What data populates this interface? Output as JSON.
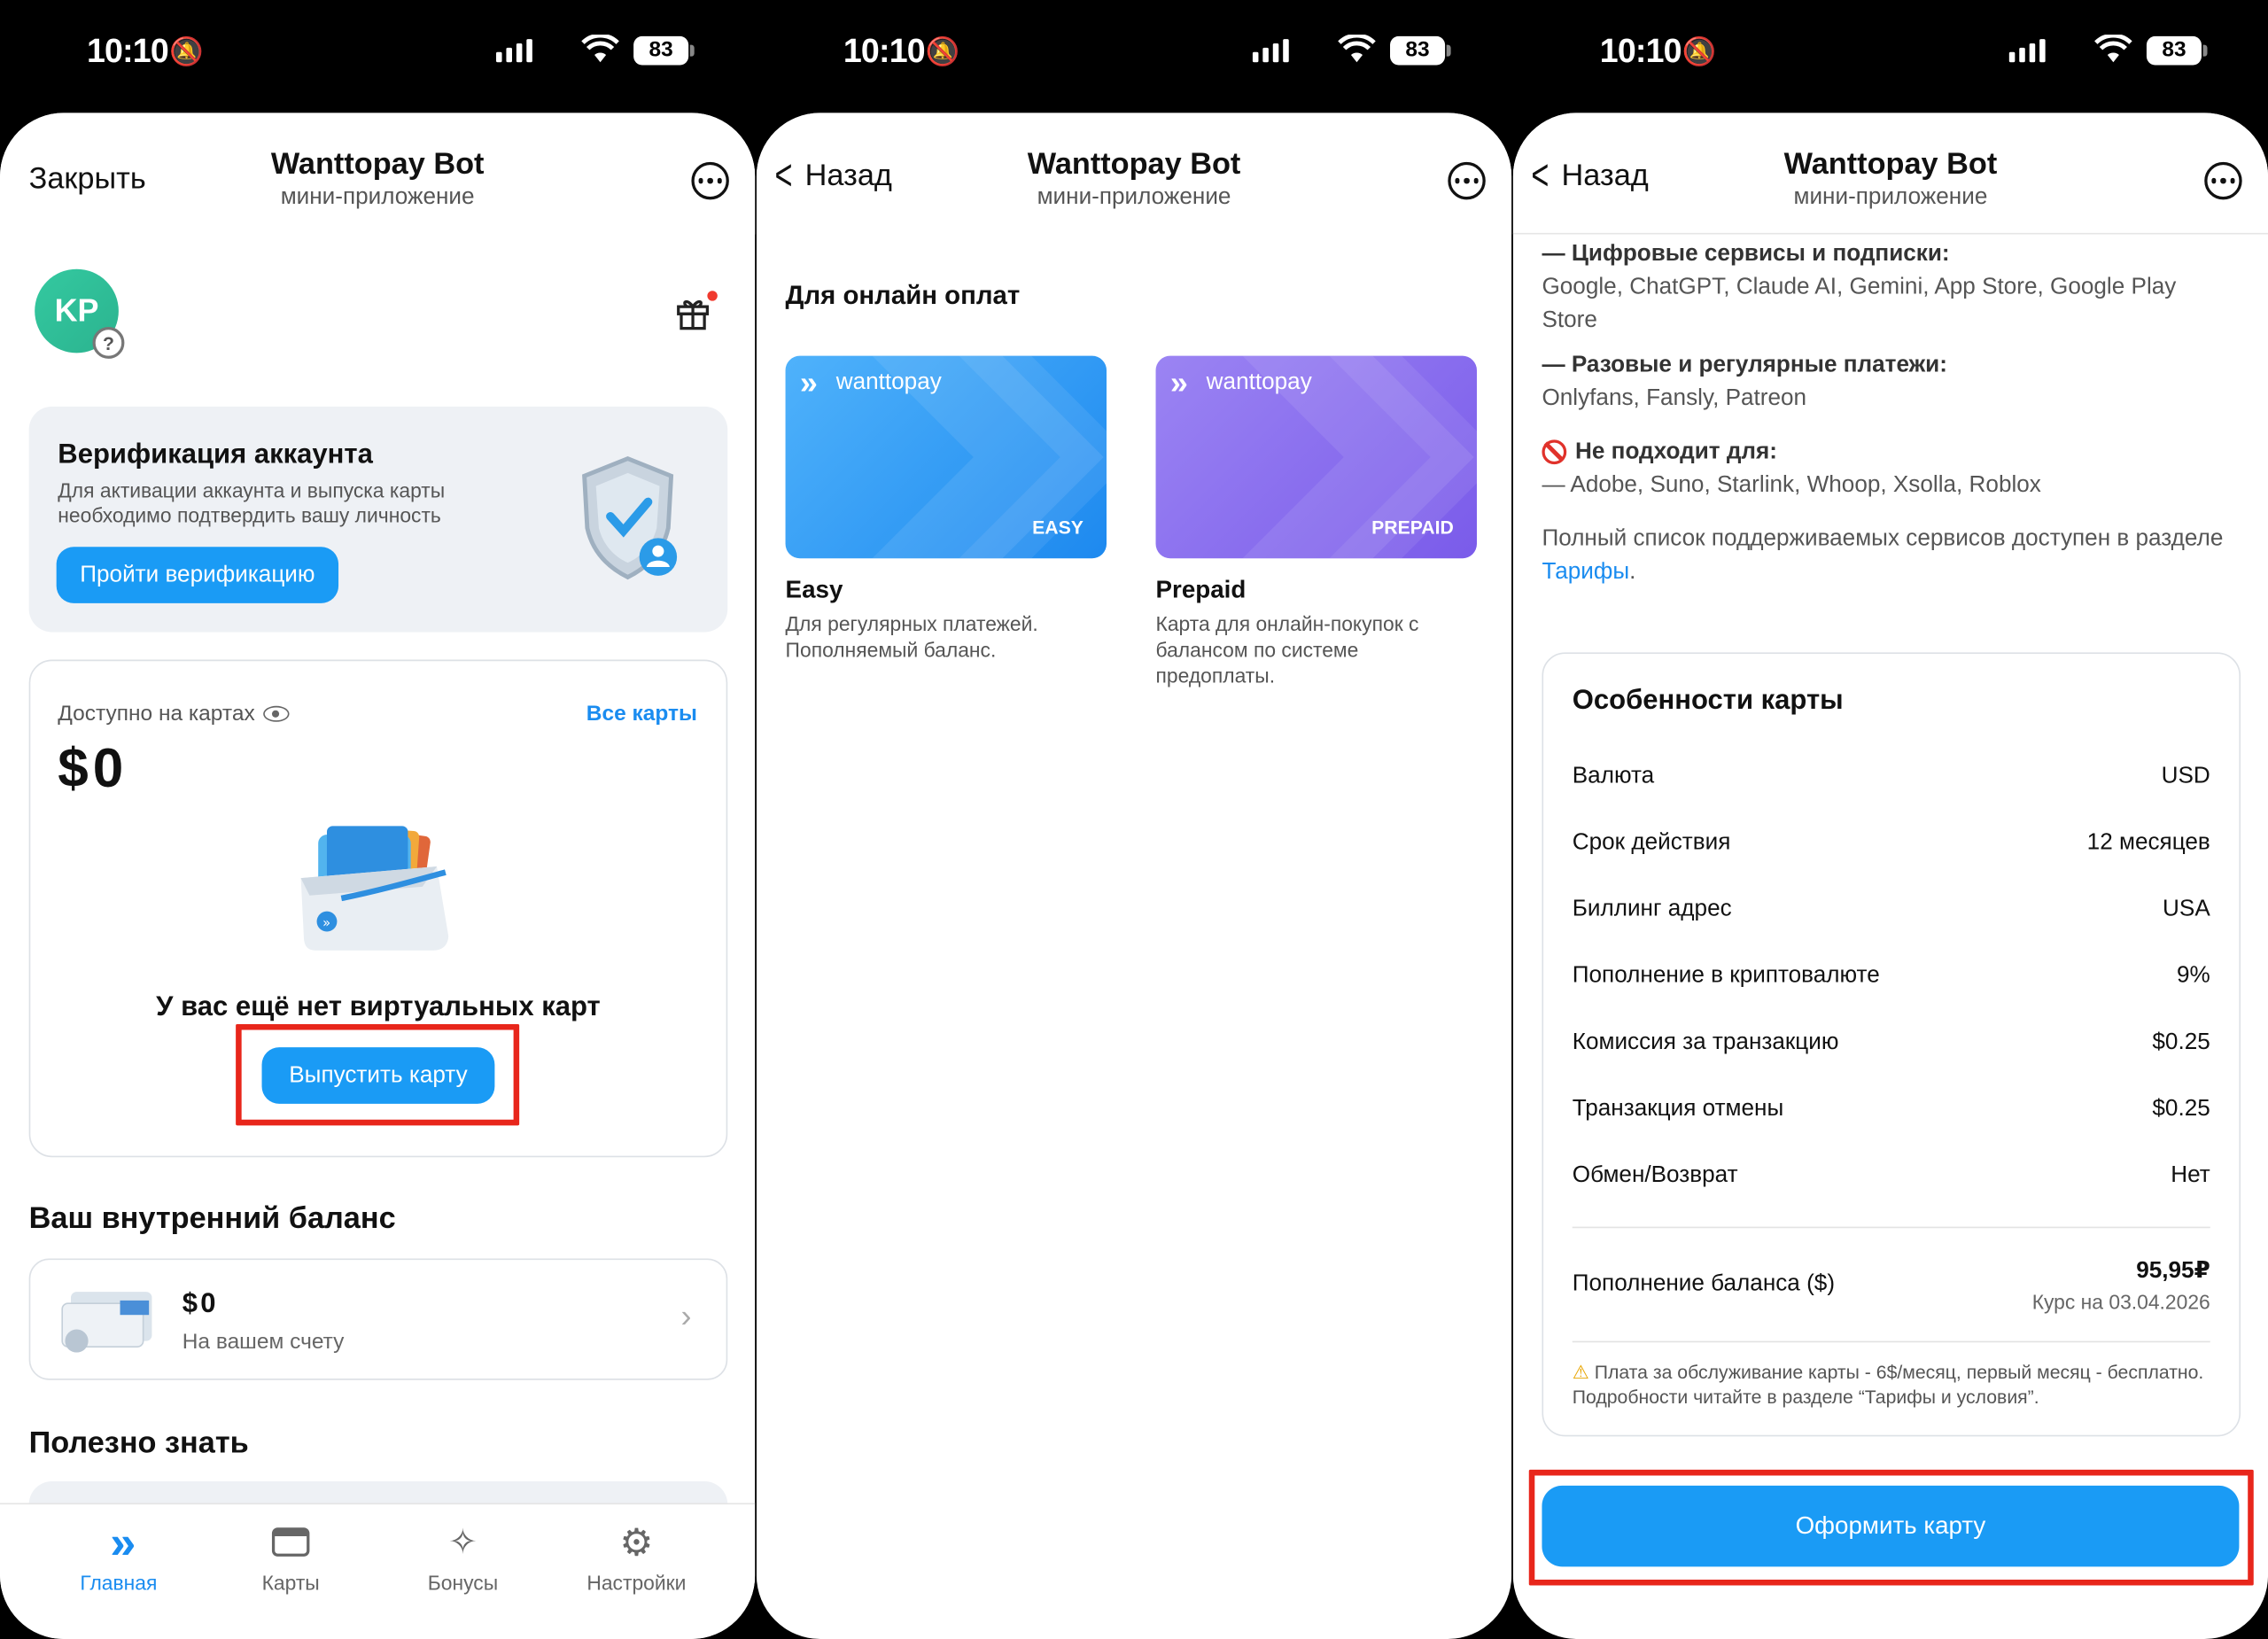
{
  "status": {
    "time": "10:10",
    "battery": "83"
  },
  "colors": {
    "accent": "#1a9bf5",
    "red_highlight": "#e8261b",
    "easy_card": "#2f9cf5",
    "prepaid_card": "#8b6df0"
  },
  "header": {
    "bot_title": "Wanttopay Bot",
    "bot_subtitle": "мини-приложение",
    "close": "Закрыть",
    "back": "Назад"
  },
  "screen1": {
    "avatar_initials": "KP",
    "verify": {
      "title": "Верификация аккаунта",
      "desc": "Для активации аккаунта и выпуска карты необходимо подтвердить вашу личность",
      "button": "Пройти верификацию"
    },
    "cards": {
      "available_label": "Доступно на картах",
      "all_cards": "Все карты",
      "amount": "$0",
      "empty_text": "У вас ещё нет виртуальных карт",
      "issue_button": "Выпустить карту"
    },
    "internal_balance": {
      "title": "Ваш внутренний баланс",
      "amount": "$0",
      "caption": "На вашем счету"
    },
    "useful_title": "Полезно знать",
    "nav": {
      "home": "Главная",
      "cards": "Карты",
      "bonuses": "Бонусы",
      "settings": "Настройки"
    }
  },
  "screen2": {
    "section_title": "Для онлайн оплат",
    "brand": "wanttopay",
    "easy": {
      "badge": "EASY",
      "name": "Easy",
      "desc": "Для регулярных платежей. Пополняемый баланс."
    },
    "prepaid": {
      "badge": "PREPAID",
      "name": "Prepaid",
      "desc": "Карта для онлайн-покупок с балансом по системе предоплаты."
    }
  },
  "screen3": {
    "digital_title": "— Цифровые сервисы и подписки:",
    "digital_list": "Google, ChatGPT, Claude AI, Gemini, App Store, Google Play Store",
    "oneoff_title": "— Разовые и регулярные платежи:",
    "oneoff_list": "Onlyfans, Fansly, Patreon",
    "notfit_title": "Не подходит для:",
    "notfit_list": "— Adobe, Suno, Starlink, Whoop, Xsolla, Roblox",
    "full_list_text": "Полный список поддерживаемых сервисов доступен в разделе ",
    "full_list_link": "Тарифы",
    "full_list_end": ".",
    "features_title": "Особенности карты",
    "features": [
      {
        "label": "Валюта",
        "value": "USD"
      },
      {
        "label": "Срок действия",
        "value": "12 месяцев"
      },
      {
        "label": "Биллинг адрес",
        "value": "USA"
      },
      {
        "label": "Пополнение в криптовалюте",
        "value": "9%"
      },
      {
        "label": "Комиссия за транзакцию",
        "value": "$0.25"
      },
      {
        "label": "Транзакция отмены",
        "value": "$0.25"
      },
      {
        "label": "Обмен/Возврат",
        "value": "Нет"
      }
    ],
    "topup_label": "Пополнение баланса ($)",
    "topup_value": "95,95₽",
    "topup_rate": "Курс на 03.04.2026",
    "fee_note": "Плата за обслуживание карты - 6$/месяц, первый месяц - бесплатно. Подробности читайте в разделе “Тарифы и условия”.",
    "submit_button": "Оформить карту"
  }
}
